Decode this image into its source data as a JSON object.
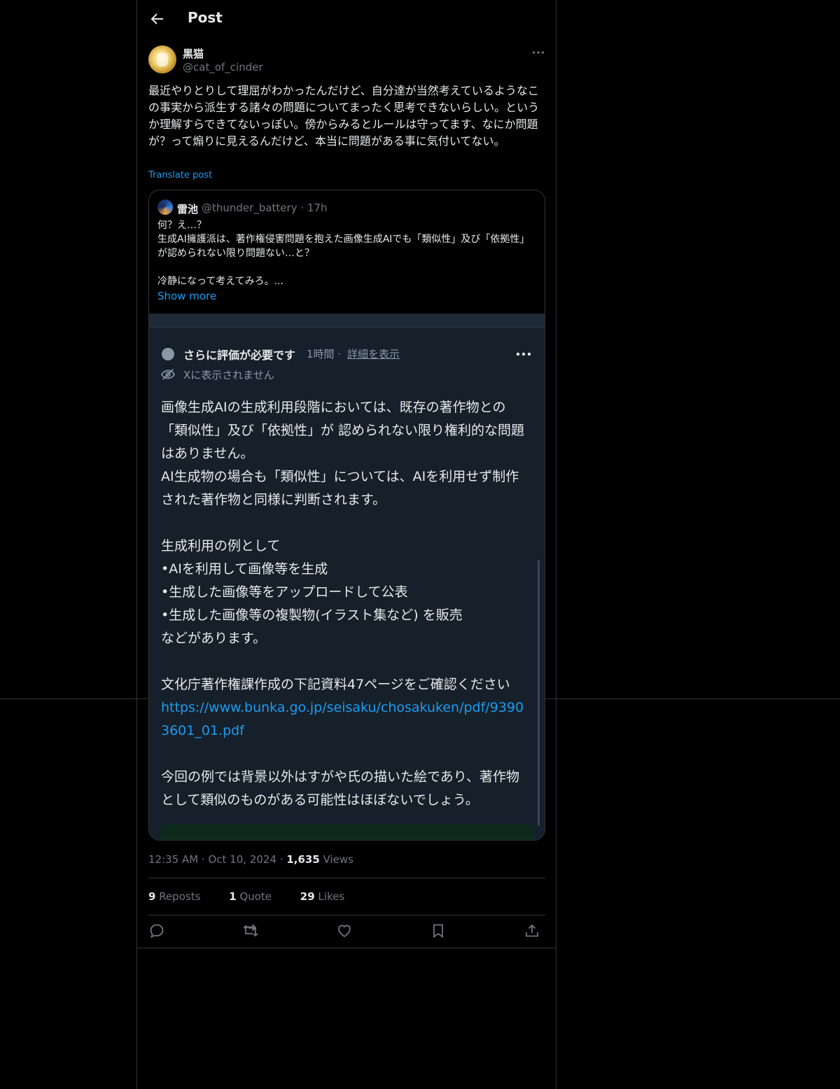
{
  "header": {
    "title": "Post"
  },
  "post": {
    "author_name": "黒猫",
    "author_handle": "@cat_of_cinder",
    "text": "最近やりとりして理屈がわかったんだけど、自分達が当然考えているようなこの事実から派生する諸々の問題についてまったく思考できないらしい。というか理解すらできてないっぽい。傍からみるとルールは守ってます、なにか問題が？って煽りに見えるんだけど、本当に問題がある事に気付いてない。",
    "translate_label": "Translate post",
    "timestamp": "12:35 AM · Oct 10, 2024 · ",
    "views_count": "1,635",
    "views_label": " Views"
  },
  "quote": {
    "name": "雷池",
    "handle_time": "@thunder_battery · 17h",
    "lines": [
      "何？え…？",
      "生成AI擁護派は、著作権侵害問題を抱えた画像生成AIでも「類似性」及び「依拠性」が認められない限り問題ない…と？",
      "",
      "冷静になって考えてみろ。..."
    ],
    "show_more": "Show more"
  },
  "note": {
    "title": "さらに評価が必要です",
    "time": "1時間 · ",
    "detail_link": "詳細を表示",
    "hidden_label": "Xに表示されません",
    "body": [
      "画像生成AIの生成利用段階においては、既存の著作物との「類似性」及び「依拠性」が 認められない限り権利的な問題はありません。",
      "AI生成物の場合も「類似性」については、AIを利用せず制作された著作物と同様に判断されます。",
      "",
      "生成利用の例として",
      "•AIを利用して画像等を生成",
      "•生成した画像等をアップロードして公表",
      "•生成した画像等の複製物(イラスト集など) を販売",
      "などがあります。",
      "",
      "文化庁著作権課作成の下記資料47ページをご確認ください"
    ],
    "link": "https://www.bunka.go.jp/seisaku/chosakuken/pdf/93903601_01.pdf",
    "body2": [
      "",
      "今回の例では背景以外はすがや氏の描いた絵であり、著作物として類似のものがある可能性はほぼないでしょう。"
    ]
  },
  "stats": {
    "reposts_count": "9",
    "reposts_label": " Reposts",
    "quotes_count": "1",
    "quotes_label": " Quote",
    "likes_count": "29",
    "likes_label": " Likes"
  },
  "icons": {
    "back": "arrow-left-icon",
    "more": "more-horizontal-icon",
    "eye_off": "eye-slash-icon",
    "reply": "reply-icon",
    "repost": "repost-icon",
    "like": "heart-icon",
    "bookmark": "bookmark-icon",
    "share": "share-icon"
  },
  "colors": {
    "accent": "#1d9bf0",
    "note_bg": "#16202a",
    "muted": "#71767b"
  }
}
